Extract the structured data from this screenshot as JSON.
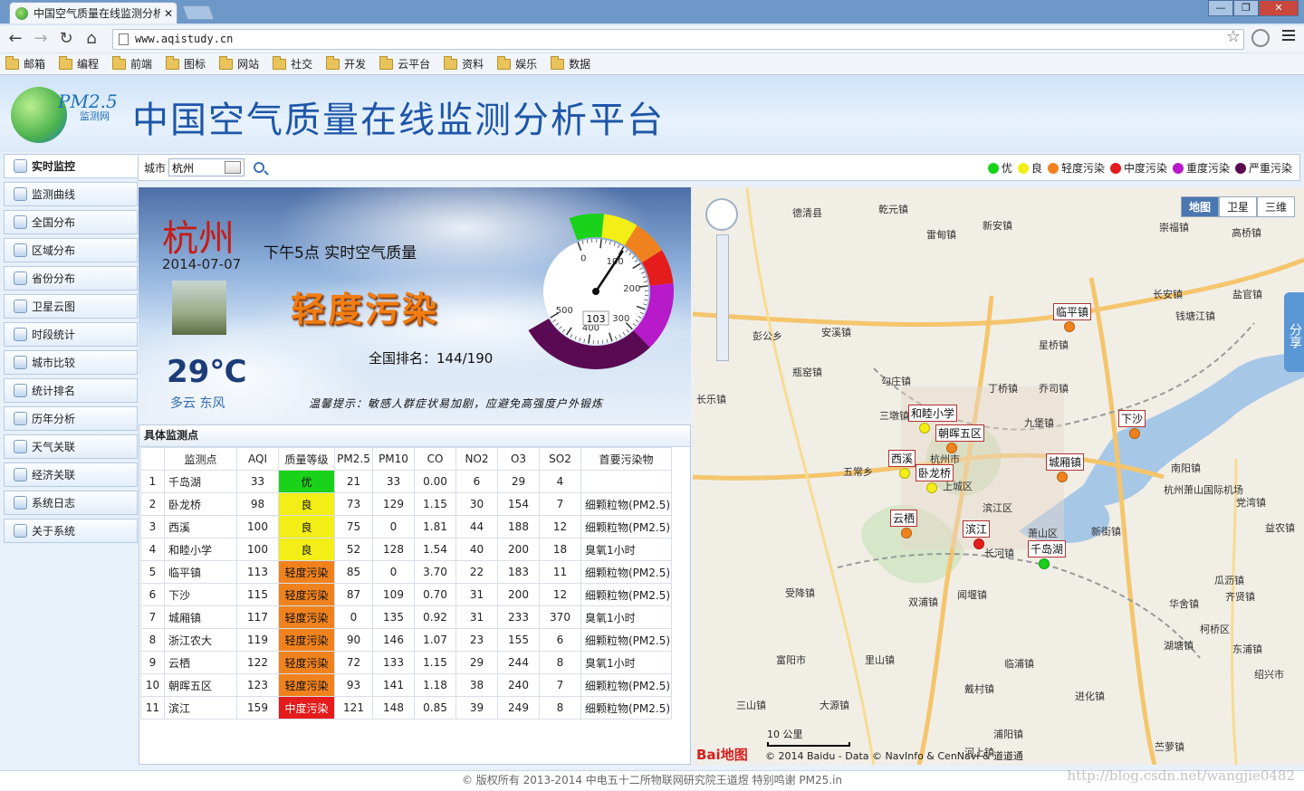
{
  "browser": {
    "tab_title": "中国空气质量在线监测分析",
    "tab_close": "✕",
    "win_buttons": [
      "—",
      "❐",
      "✕"
    ],
    "url": "www.aqistudy.cn",
    "bookmarks": [
      "邮箱",
      "编程",
      "前端",
      "图标",
      "网站",
      "社交",
      "开发",
      "云平台",
      "资料",
      "娱乐",
      "数据"
    ]
  },
  "site": {
    "logo_text": "PM2.5",
    "logo_sub": "监测网",
    "title": "中国空气质量在线监测分析平台"
  },
  "sidebar": {
    "items": [
      {
        "label": "实时监控",
        "icon": "monitor-icon",
        "active": true
      },
      {
        "label": "监测曲线",
        "icon": "curve-icon"
      },
      {
        "label": "全国分布",
        "icon": "map-icon"
      },
      {
        "label": "区域分布",
        "icon": "region-icon"
      },
      {
        "label": "省份分布",
        "icon": "province-icon"
      },
      {
        "label": "卫星云图",
        "icon": "satellite-icon"
      },
      {
        "label": "时段统计",
        "icon": "clock-icon"
      },
      {
        "label": "城市比较",
        "icon": "compare-icon"
      },
      {
        "label": "统计排名",
        "icon": "rank-icon"
      },
      {
        "label": "历年分析",
        "icon": "history-icon"
      },
      {
        "label": "天气关联",
        "icon": "weather-icon"
      },
      {
        "label": "经济关联",
        "icon": "economy-icon"
      },
      {
        "label": "系统日志",
        "icon": "log-icon"
      },
      {
        "label": "关于系统",
        "icon": "info-icon"
      }
    ]
  },
  "filter": {
    "city_label": "城市",
    "city_value": "杭州"
  },
  "legend": [
    {
      "label": "优",
      "color": "#19d219"
    },
    {
      "label": "良",
      "color": "#f2ee16"
    },
    {
      "label": "轻度污染",
      "color": "#f0821e"
    },
    {
      "label": "中度污染",
      "color": "#e51c1c"
    },
    {
      "label": "重度污染",
      "color": "#b71ac9"
    },
    {
      "label": "严重污染",
      "color": "#5a0a52"
    }
  ],
  "hero": {
    "city": "杭州",
    "date": "2014-07-07",
    "temperature": "29℃",
    "weather": "多云 东风",
    "subtitle": "下午5点 实时空气质量",
    "level": "轻度污染",
    "rank": "全国排名：144/190",
    "tip": "温馨提示：敏感人群症状易加剧，应避免高强度户外锻炼",
    "aqi": "103",
    "aqi_value": 103,
    "gauge_ticks": [
      "0",
      "100",
      "200",
      "300",
      "400",
      "500"
    ]
  },
  "detail": {
    "title": "具体监测点",
    "columns": [
      "",
      "监测点",
      "AQI",
      "质量等级",
      "PM2.5",
      "PM10",
      "CO",
      "NO2",
      "O3",
      "SO2",
      "首要污染物"
    ],
    "rows": [
      [
        "1",
        "千岛湖",
        "33",
        "优",
        "21",
        "33",
        "0.00",
        "6",
        "29",
        "4",
        ""
      ],
      [
        "2",
        "卧龙桥",
        "98",
        "良",
        "73",
        "129",
        "1.15",
        "30",
        "154",
        "7",
        "细颗粒物(PM2.5)"
      ],
      [
        "3",
        "西溪",
        "100",
        "良",
        "75",
        "0",
        "1.81",
        "44",
        "188",
        "12",
        "细颗粒物(PM2.5)"
      ],
      [
        "4",
        "和睦小学",
        "100",
        "良",
        "52",
        "128",
        "1.54",
        "40",
        "200",
        "18",
        "臭氧1小时"
      ],
      [
        "5",
        "临平镇",
        "113",
        "轻度污染",
        "85",
        "0",
        "3.70",
        "22",
        "183",
        "11",
        "细颗粒物(PM2.5)"
      ],
      [
        "6",
        "下沙",
        "115",
        "轻度污染",
        "87",
        "109",
        "0.70",
        "31",
        "200",
        "12",
        "细颗粒物(PM2.5)"
      ],
      [
        "7",
        "城厢镇",
        "117",
        "轻度污染",
        "0",
        "135",
        "0.92",
        "31",
        "233",
        "370",
        "臭氧1小时"
      ],
      [
        "8",
        "浙江农大",
        "119",
        "轻度污染",
        "90",
        "146",
        "1.07",
        "23",
        "155",
        "6",
        "细颗粒物(PM2.5)"
      ],
      [
        "9",
        "云栖",
        "122",
        "轻度污染",
        "72",
        "133",
        "1.15",
        "29",
        "244",
        "8",
        "臭氧1小时"
      ],
      [
        "10",
        "朝晖五区",
        "123",
        "轻度污染",
        "93",
        "141",
        "1.18",
        "38",
        "240",
        "7",
        "细颗粒物(PM2.5)"
      ],
      [
        "11",
        "滨江",
        "159",
        "中度污染",
        "121",
        "148",
        "0.85",
        "39",
        "249",
        "8",
        "细颗粒物(PM2.5)"
      ]
    ]
  },
  "map": {
    "types": [
      "地图",
      "卫星",
      "三维"
    ],
    "share": "分享",
    "station_labels": [
      "临平镇",
      "和睦小学",
      "朝晖五区",
      "下沙",
      "西溪",
      "卧龙桥",
      "城厢镇",
      "云栖",
      "滨江",
      "千岛湖"
    ],
    "place_labels": [
      "德清县",
      "乾元镇",
      "雷甸镇",
      "新安镇",
      "崇福镇",
      "高桥镇",
      "长安镇",
      "盐官镇",
      "钱塘江镇",
      "彭公乡",
      "安溪镇",
      "星桥镇",
      "瓶窑镇",
      "勾庄镇",
      "丁桥镇",
      "乔司镇",
      "长乐镇",
      "三墩镇",
      "九堡镇",
      "五常乡",
      "杭州市",
      "上城区",
      "南阳镇",
      "杭州萧山国际机场",
      "党湾镇",
      "新街镇",
      "益农镇",
      "滨江区",
      "萧山区",
      "长河镇",
      "受降镇",
      "双浦镇",
      "闻堰镇",
      "瓜沥镇",
      "华舍镇",
      "齐贤镇",
      "柯桥区",
      "湖塘镇",
      "东浦镇",
      "富阳市",
      "里山镇",
      "临浦镇",
      "戴村镇",
      "进化镇",
      "三山镇",
      "大源镇",
      "浦阳镇",
      "河上镇",
      "苎萝镇",
      "绍兴市"
    ],
    "scale": "10 公里",
    "logo": "Bai地图",
    "copyright": "© 2014 Baidu - Data © NavInfo & CenNavi & 道道通"
  },
  "footer": {
    "text": "© 版权所有 2013-2014 中电五十二所物联网研究院王道煜 特别鸣谢 PM25.in",
    "watermark": "http://blog.csdn.net/wangjie0482"
  }
}
